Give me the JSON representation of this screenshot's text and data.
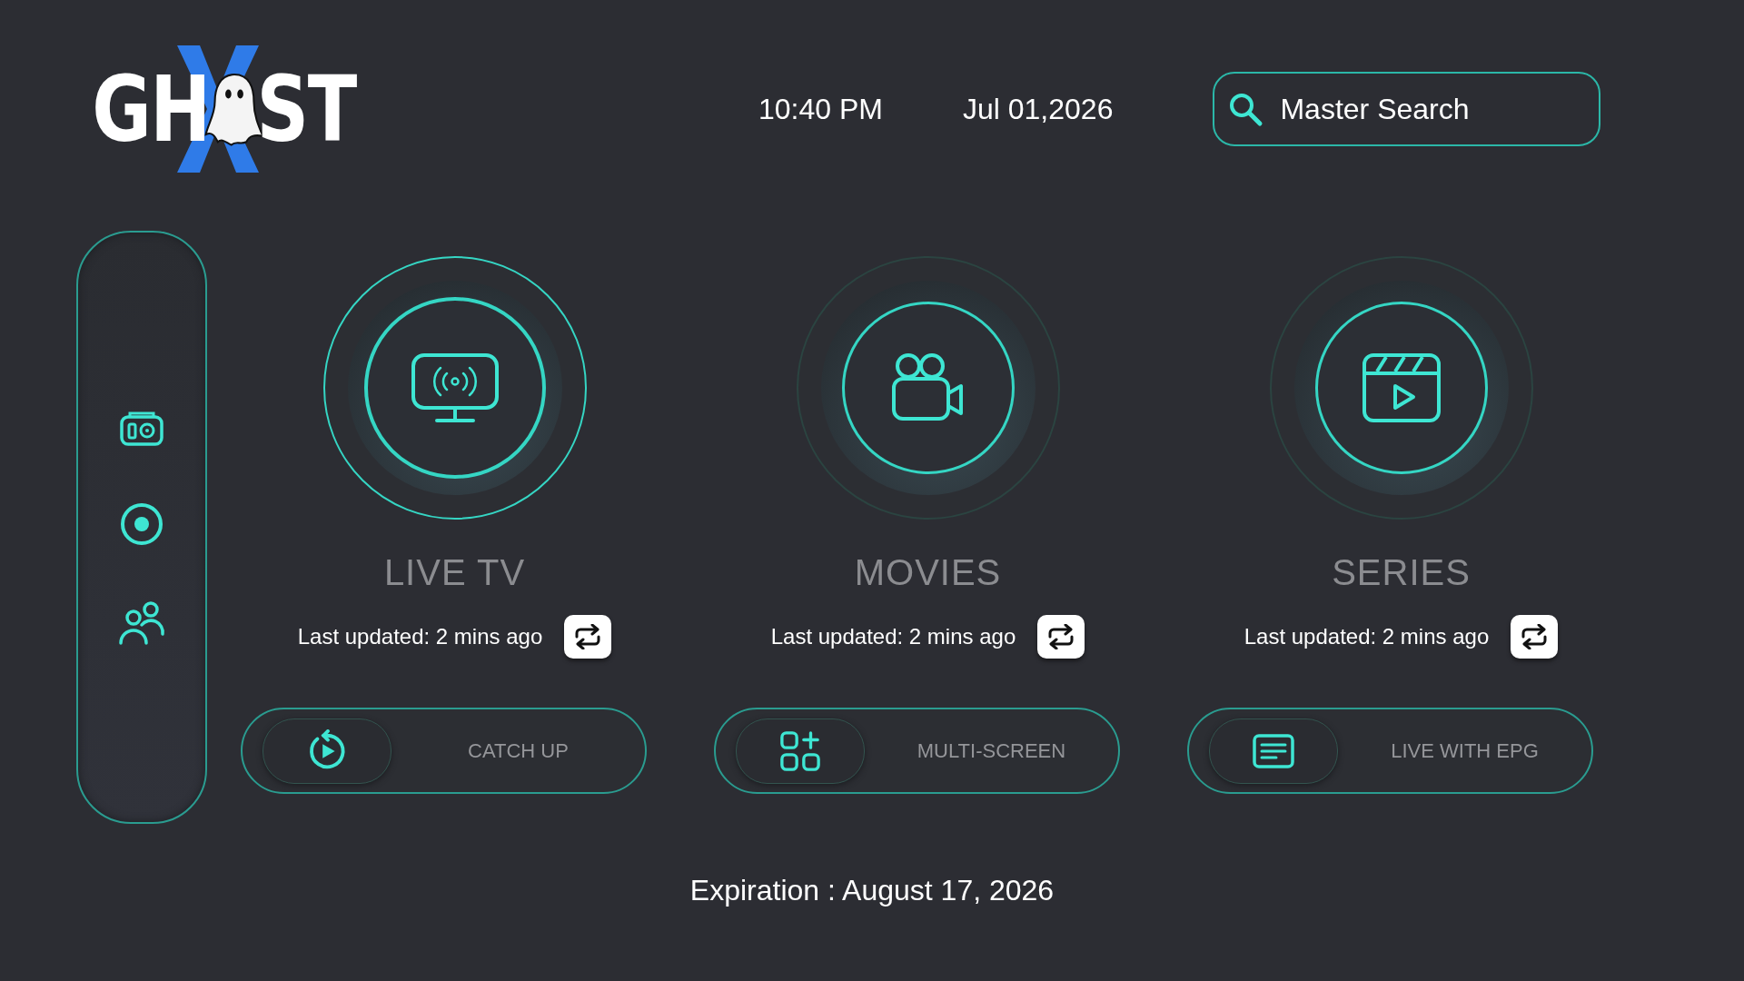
{
  "logo": {
    "left": "GH",
    "right": "ST"
  },
  "header": {
    "time": "10:40 PM",
    "date": "Jul 01,2026"
  },
  "search": {
    "placeholder": "Master Search"
  },
  "categories": [
    {
      "title": "LIVE TV",
      "updated": "Last updated: 2 mins ago",
      "selected": true
    },
    {
      "title": "MOVIES",
      "updated": "Last updated: 2 mins ago",
      "selected": false
    },
    {
      "title": "SERIES",
      "updated": "Last updated: 2 mins ago",
      "selected": false
    }
  ],
  "actions": [
    {
      "label": "CATCH UP"
    },
    {
      "label": "MULTI-SCREEN"
    },
    {
      "label": "LIVE WITH EPG"
    }
  ],
  "expiration": "Expiration : August 17, 2026"
}
